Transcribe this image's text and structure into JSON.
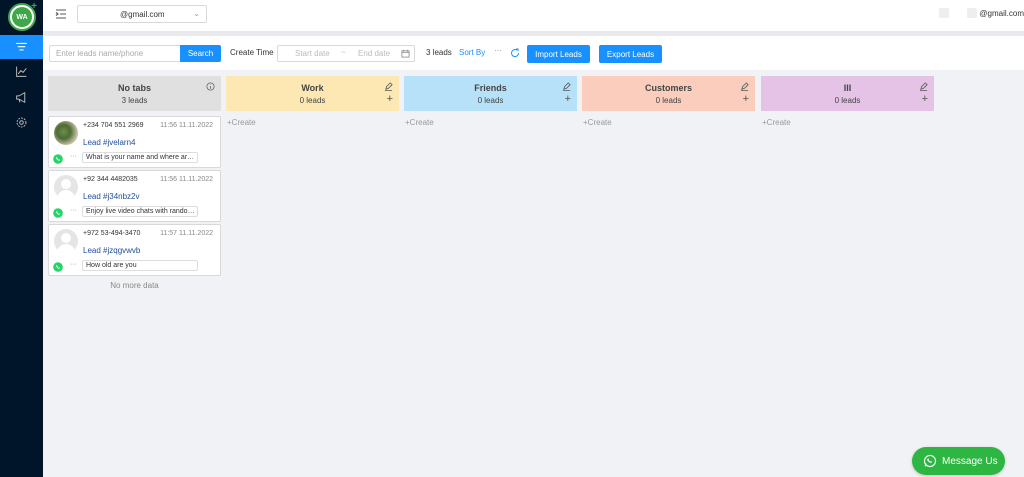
{
  "app": {
    "logo_text": "WA",
    "account_email": "@gmail.com",
    "user_email": "@gmail.com"
  },
  "sidebar": {
    "items": [
      {
        "icon": "funnel-icon",
        "active": true
      },
      {
        "icon": "line-chart-icon",
        "active": false
      },
      {
        "icon": "megaphone-icon",
        "active": false
      },
      {
        "icon": "gear-icon",
        "active": false
      }
    ]
  },
  "toolbar": {
    "search_placeholder": "Enter leads name/phone",
    "search_label": "Search",
    "create_time_label": "Create Time",
    "start_date_placeholder": "Start date",
    "date_separator": "~",
    "end_date_placeholder": "End date",
    "lead_count": "3 leads",
    "sort_by_label": "Sort By",
    "more_label": "···",
    "import_label": "Import Leads",
    "export_label": "Export Leads"
  },
  "columns": [
    {
      "title": "No tabs",
      "count": "3 leads",
      "color": "#e0e0e0"
    },
    {
      "title": "Work",
      "count": "0 leads",
      "color": "#fde8b4",
      "create_label": "Create"
    },
    {
      "title": "Friends",
      "count": "0 leads",
      "color": "#b7e1f8",
      "create_label": "Create"
    },
    {
      "title": "Customers",
      "count": "0 leads",
      "color": "#fbcdbc",
      "create_label": "Create"
    },
    {
      "title": "III",
      "count": "0 leads",
      "color": "#e4c3e7",
      "create_label": "Create"
    }
  ],
  "cards": [
    {
      "phone": "+234 704 551 2969",
      "time": "11:56 11.11.2022",
      "lead": "Lead #jvelarn4",
      "dots": "···",
      "message": "What is your name and where are ..."
    },
    {
      "phone": "+92 344 4482035",
      "time": "11:56 11.11.2022",
      "lead": "Lead #j34nbz2v",
      "dots": "···",
      "message": "Enjoy live video chats with random..."
    },
    {
      "phone": "+972 53-494-3470",
      "time": "11:57 11.11.2022",
      "lead": "Lead #jzqgvwvb",
      "dots": "···",
      "message": "How old are you"
    }
  ],
  "no_more_data": "No more data",
  "chat_button_label": "Message Us",
  "colors": {
    "sidebar_bg": "#001529",
    "primary": "#1890ff",
    "whatsapp": "#2db742"
  }
}
